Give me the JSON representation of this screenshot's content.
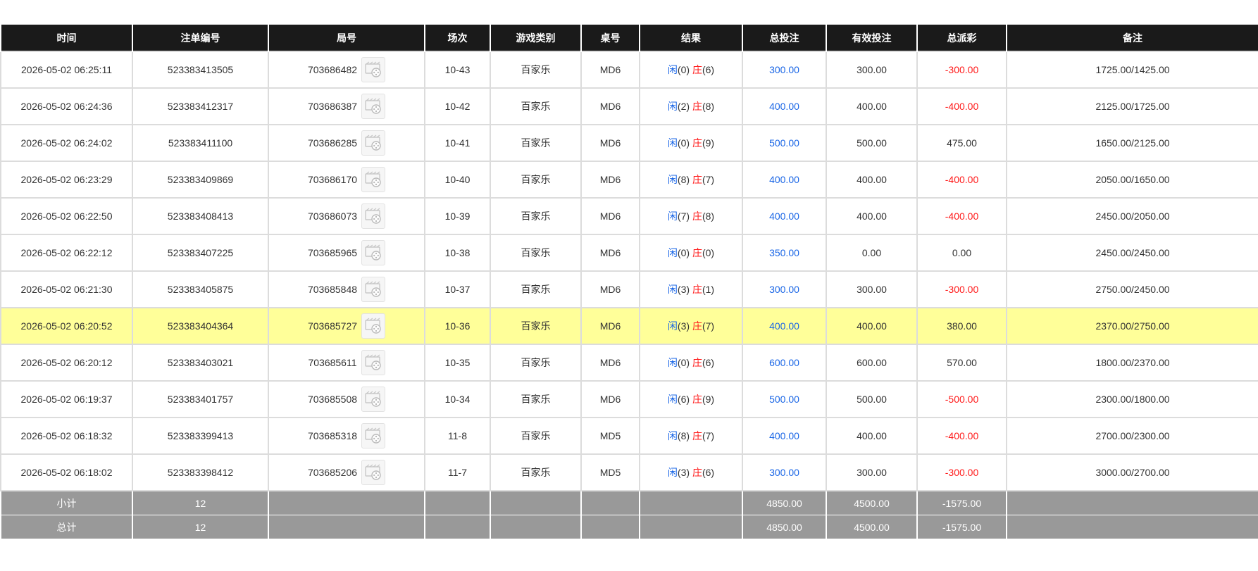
{
  "headers": [
    "时间",
    "注单编号",
    "局号",
    "场次",
    "游戏类别",
    "桌号",
    "结果",
    "总投注",
    "有效投注",
    "总派彩",
    "备注"
  ],
  "colors": {
    "header_bg": "#1a1a1a",
    "highlight": "#ffff99",
    "summary_bg": "#999999",
    "blue": "#1a66e6",
    "red": "#ff1a1a"
  },
  "replay_icon": "video-replay-icon",
  "rows": [
    {
      "time": "2026-05-02 06:25:11",
      "bet_id": "523383413505",
      "round": "703686482",
      "session": "10-43",
      "game": "百家乐",
      "table": "MD6",
      "player_label": "闲",
      "player_score": "(0)",
      "banker_label": "庄",
      "banker_score": "(6)",
      "total_bet": "300.00",
      "valid_bet": "300.00",
      "payout": "-300.00",
      "payout_negative": true,
      "note": "1725.00/1425.00",
      "highlight": false
    },
    {
      "time": "2026-05-02 06:24:36",
      "bet_id": "523383412317",
      "round": "703686387",
      "session": "10-42",
      "game": "百家乐",
      "table": "MD6",
      "player_label": "闲",
      "player_score": "(2)",
      "banker_label": "庄",
      "banker_score": "(8)",
      "total_bet": "400.00",
      "valid_bet": "400.00",
      "payout": "-400.00",
      "payout_negative": true,
      "note": "2125.00/1725.00",
      "highlight": false
    },
    {
      "time": "2026-05-02 06:24:02",
      "bet_id": "523383411100",
      "round": "703686285",
      "session": "10-41",
      "game": "百家乐",
      "table": "MD6",
      "player_label": "闲",
      "player_score": "(0)",
      "banker_label": "庄",
      "banker_score": "(9)",
      "total_bet": "500.00",
      "valid_bet": "500.00",
      "payout": "475.00",
      "payout_negative": false,
      "note": "1650.00/2125.00",
      "highlight": false
    },
    {
      "time": "2026-05-02 06:23:29",
      "bet_id": "523383409869",
      "round": "703686170",
      "session": "10-40",
      "game": "百家乐",
      "table": "MD6",
      "player_label": "闲",
      "player_score": "(8)",
      "banker_label": "庄",
      "banker_score": "(7)",
      "total_bet": "400.00",
      "valid_bet": "400.00",
      "payout": "-400.00",
      "payout_negative": true,
      "note": "2050.00/1650.00",
      "highlight": false
    },
    {
      "time": "2026-05-02 06:22:50",
      "bet_id": "523383408413",
      "round": "703686073",
      "session": "10-39",
      "game": "百家乐",
      "table": "MD6",
      "player_label": "闲",
      "player_score": "(7)",
      "banker_label": "庄",
      "banker_score": "(8)",
      "total_bet": "400.00",
      "valid_bet": "400.00",
      "payout": "-400.00",
      "payout_negative": true,
      "note": "2450.00/2050.00",
      "highlight": false
    },
    {
      "time": "2026-05-02 06:22:12",
      "bet_id": "523383407225",
      "round": "703685965",
      "session": "10-38",
      "game": "百家乐",
      "table": "MD6",
      "player_label": "闲",
      "player_score": "(0)",
      "banker_label": "庄",
      "banker_score": "(0)",
      "total_bet": "350.00",
      "valid_bet": "0.00",
      "payout": "0.00",
      "payout_negative": false,
      "note": "2450.00/2450.00",
      "highlight": false
    },
    {
      "time": "2026-05-02 06:21:30",
      "bet_id": "523383405875",
      "round": "703685848",
      "session": "10-37",
      "game": "百家乐",
      "table": "MD6",
      "player_label": "闲",
      "player_score": "(3)",
      "banker_label": "庄",
      "banker_score": "(1)",
      "total_bet": "300.00",
      "valid_bet": "300.00",
      "payout": "-300.00",
      "payout_negative": true,
      "note": "2750.00/2450.00",
      "highlight": false
    },
    {
      "time": "2026-05-02 06:20:52",
      "bet_id": "523383404364",
      "round": "703685727",
      "session": "10-36",
      "game": "百家乐",
      "table": "MD6",
      "player_label": "闲",
      "player_score": "(3)",
      "banker_label": "庄",
      "banker_score": "(7)",
      "total_bet": "400.00",
      "valid_bet": "400.00",
      "payout": "380.00",
      "payout_negative": false,
      "note": "2370.00/2750.00",
      "highlight": true
    },
    {
      "time": "2026-05-02 06:20:12",
      "bet_id": "523383403021",
      "round": "703685611",
      "session": "10-35",
      "game": "百家乐",
      "table": "MD6",
      "player_label": "闲",
      "player_score": "(0)",
      "banker_label": "庄",
      "banker_score": "(6)",
      "total_bet": "600.00",
      "valid_bet": "600.00",
      "payout": "570.00",
      "payout_negative": false,
      "note": "1800.00/2370.00",
      "highlight": false
    },
    {
      "time": "2026-05-02 06:19:37",
      "bet_id": "523383401757",
      "round": "703685508",
      "session": "10-34",
      "game": "百家乐",
      "table": "MD6",
      "player_label": "闲",
      "player_score": "(6)",
      "banker_label": "庄",
      "banker_score": "(9)",
      "total_bet": "500.00",
      "valid_bet": "500.00",
      "payout": "-500.00",
      "payout_negative": true,
      "note": "2300.00/1800.00",
      "highlight": false
    },
    {
      "time": "2026-05-02 06:18:32",
      "bet_id": "523383399413",
      "round": "703685318",
      "session": "11-8",
      "game": "百家乐",
      "table": "MD5",
      "player_label": "闲",
      "player_score": "(8)",
      "banker_label": "庄",
      "banker_score": "(7)",
      "total_bet": "400.00",
      "valid_bet": "400.00",
      "payout": "-400.00",
      "payout_negative": true,
      "note": "2700.00/2300.00",
      "highlight": false
    },
    {
      "time": "2026-05-02 06:18:02",
      "bet_id": "523383398412",
      "round": "703685206",
      "session": "11-7",
      "game": "百家乐",
      "table": "MD5",
      "player_label": "闲",
      "player_score": "(3)",
      "banker_label": "庄",
      "banker_score": "(6)",
      "total_bet": "300.00",
      "valid_bet": "300.00",
      "payout": "-300.00",
      "payout_negative": true,
      "note": "3000.00/2700.00",
      "highlight": false
    }
  ],
  "subtotal": {
    "label": "小计",
    "count": "12",
    "total_bet": "4850.00",
    "valid_bet": "4500.00",
    "payout": "-1575.00"
  },
  "grandtotal": {
    "label": "总计",
    "count": "12",
    "total_bet": "4850.00",
    "valid_bet": "4500.00",
    "payout": "-1575.00"
  }
}
